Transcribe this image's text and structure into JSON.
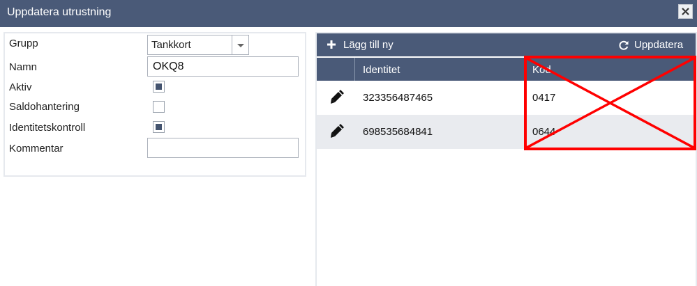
{
  "window": {
    "title": "Uppdatera utrustning",
    "close_icon": "close-icon"
  },
  "form": {
    "group_label": "Grupp",
    "group_value": "Tankkort",
    "name_label": "Namn",
    "name_value": "OKQ8",
    "active_label": "Aktiv",
    "active_checked": true,
    "balance_label": "Saldohantering",
    "balance_checked": false,
    "identity_check_label": "Identitetskontroll",
    "identity_check_checked": true,
    "comment_label": "Kommentar",
    "comment_value": ""
  },
  "grid": {
    "add_label": "Lägg till ny",
    "add_icon": "plus-icon",
    "refresh_label": "Uppdatera",
    "refresh_icon": "refresh-icon",
    "columns": [
      "",
      "Identitet",
      "Kod"
    ],
    "rows": [
      {
        "edit_icon": "pencil-icon",
        "identity": "323356487465",
        "code": "0417"
      },
      {
        "edit_icon": "pencil-icon",
        "identity": "698535684841",
        "code": "0644"
      }
    ]
  },
  "annotation": {
    "color": "#ff0000",
    "shape": "red-x-box"
  },
  "colors": {
    "header": "#4a5a78",
    "alt_row": "#e9ebef"
  }
}
